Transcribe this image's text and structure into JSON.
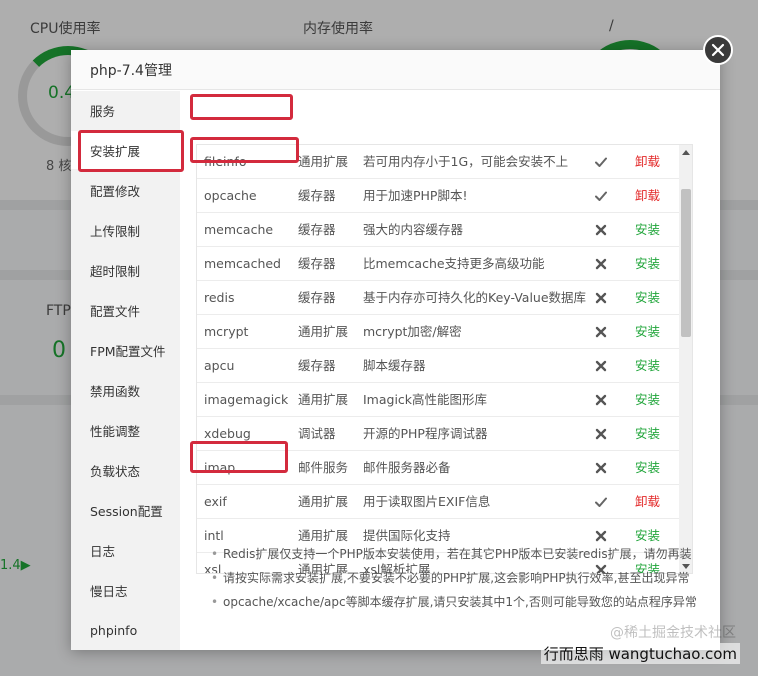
{
  "background": {
    "cpu_label": "CPU使用率",
    "cpu_value": "0.4",
    "cpu_cores": "8 核",
    "mem_label": "内存使用率",
    "disk_label": "/",
    "ftp_label": "FTP",
    "ftp_value": "0",
    "traffic_value": "1.4▶"
  },
  "dialog": {
    "title": "php-7.4管理",
    "close_label": "close"
  },
  "sidebar": {
    "items": [
      {
        "label": "服务"
      },
      {
        "label": "安装扩展"
      },
      {
        "label": "配置修改"
      },
      {
        "label": "上传限制"
      },
      {
        "label": "超时限制"
      },
      {
        "label": "配置文件"
      },
      {
        "label": "FPM配置文件"
      },
      {
        "label": "禁用函数"
      },
      {
        "label": "性能调整"
      },
      {
        "label": "负载状态"
      },
      {
        "label": "Session配置"
      },
      {
        "label": "日志"
      },
      {
        "label": "慢日志"
      },
      {
        "label": "phpinfo"
      }
    ],
    "active_index": 1
  },
  "extensions": {
    "rows": [
      {
        "name": "fileinfo",
        "type": "通用扩展",
        "desc": "若可用内存小于1G，可能会安装不上",
        "installed": true,
        "action": "卸载"
      },
      {
        "name": "opcache",
        "type": "缓存器",
        "desc": "用于加速PHP脚本!",
        "installed": true,
        "action": "卸载"
      },
      {
        "name": "memcache",
        "type": "缓存器",
        "desc": "强大的内容缓存器",
        "installed": false,
        "action": "安装"
      },
      {
        "name": "memcached",
        "type": "缓存器",
        "desc": "比memcache支持更多高级功能",
        "installed": false,
        "action": "安装"
      },
      {
        "name": "redis",
        "type": "缓存器",
        "desc": "基于内存亦可持久化的Key-Value数据库",
        "installed": false,
        "action": "安装"
      },
      {
        "name": "mcrypt",
        "type": "通用扩展",
        "desc": "mcrypt加密/解密",
        "installed": false,
        "action": "安装"
      },
      {
        "name": "apcu",
        "type": "缓存器",
        "desc": "脚本缓存器",
        "installed": false,
        "action": "安装"
      },
      {
        "name": "imagemagick",
        "type": "通用扩展",
        "desc": "Imagick高性能图形库",
        "installed": false,
        "action": "安装"
      },
      {
        "name": "xdebug",
        "type": "调试器",
        "desc": "开源的PHP程序调试器",
        "installed": false,
        "action": "安装"
      },
      {
        "name": "imap",
        "type": "邮件服务",
        "desc": "邮件服务器必备",
        "installed": false,
        "action": "安装"
      },
      {
        "name": "exif",
        "type": "通用扩展",
        "desc": "用于读取图片EXIF信息",
        "installed": true,
        "action": "卸载"
      },
      {
        "name": "intl",
        "type": "通用扩展",
        "desc": "提供国际化支持",
        "installed": false,
        "action": "安装"
      },
      {
        "name": "xsl",
        "type": "通用扩展",
        "desc": "xsl解析扩展",
        "installed": false,
        "action": "安装"
      }
    ]
  },
  "notes": [
    "Redis扩展仅支持一个PHP版本安装使用，若在其它PHP版本已安装redis扩展，请勿再装",
    "请按实际需求安装扩展,不要安装不必要的PHP扩展,这会影响PHP执行效率,甚至出现异常",
    "opcache/xcache/apc等脚本缓存扩展,请只安装其中1个,否则可能导致您的站点程序异常"
  ],
  "watermark": {
    "faint": "@稀土掘金技术社区",
    "main": "行而思雨 wangtuchao.com"
  },
  "colors": {
    "accent": "#20a53a",
    "danger": "#e32929",
    "highlight_box": "#d32a3d"
  }
}
